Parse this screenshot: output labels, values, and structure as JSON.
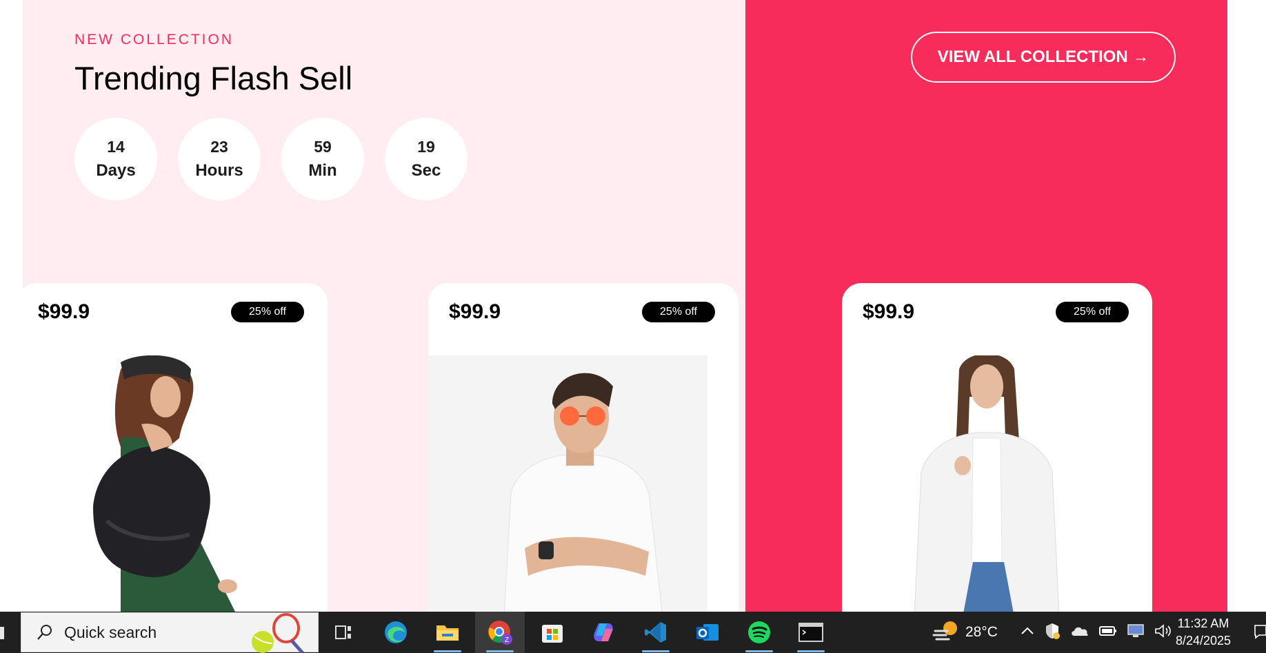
{
  "hero": {
    "eyebrow": "NEW COLLECTION",
    "title": "Trending Flash Sell",
    "cta_label": "VIEW ALL COLLECTION →"
  },
  "countdown": [
    {
      "value": "14",
      "unit": "Days"
    },
    {
      "value": "23",
      "unit": "Hours"
    },
    {
      "value": "59",
      "unit": "Min"
    },
    {
      "value": "19",
      "unit": "Sec"
    }
  ],
  "products": [
    {
      "price": "$99.9",
      "badge": "25% off",
      "image": "woman-black-jacket-green-dress"
    },
    {
      "price": "$99.9",
      "badge": "25% off",
      "image": "man-white-tshirt-orange-sunglasses"
    },
    {
      "price": "$99.9",
      "badge": "25% off",
      "image": "woman-white-coat-jeans"
    }
  ],
  "taskbar": {
    "search_placeholder": "Quick search",
    "apps": [
      "task-view",
      "edge",
      "file-explorer",
      "chrome",
      "microsoft-store",
      "copilot",
      "vscode",
      "outlook",
      "spotify",
      "terminal"
    ],
    "temperature": "28°C",
    "time": "11:32 AM",
    "date": "8/24/2025"
  },
  "colors": {
    "accent": "#f72c5b",
    "pink_bg": "#ffedf1",
    "taskbar": "#202020"
  }
}
